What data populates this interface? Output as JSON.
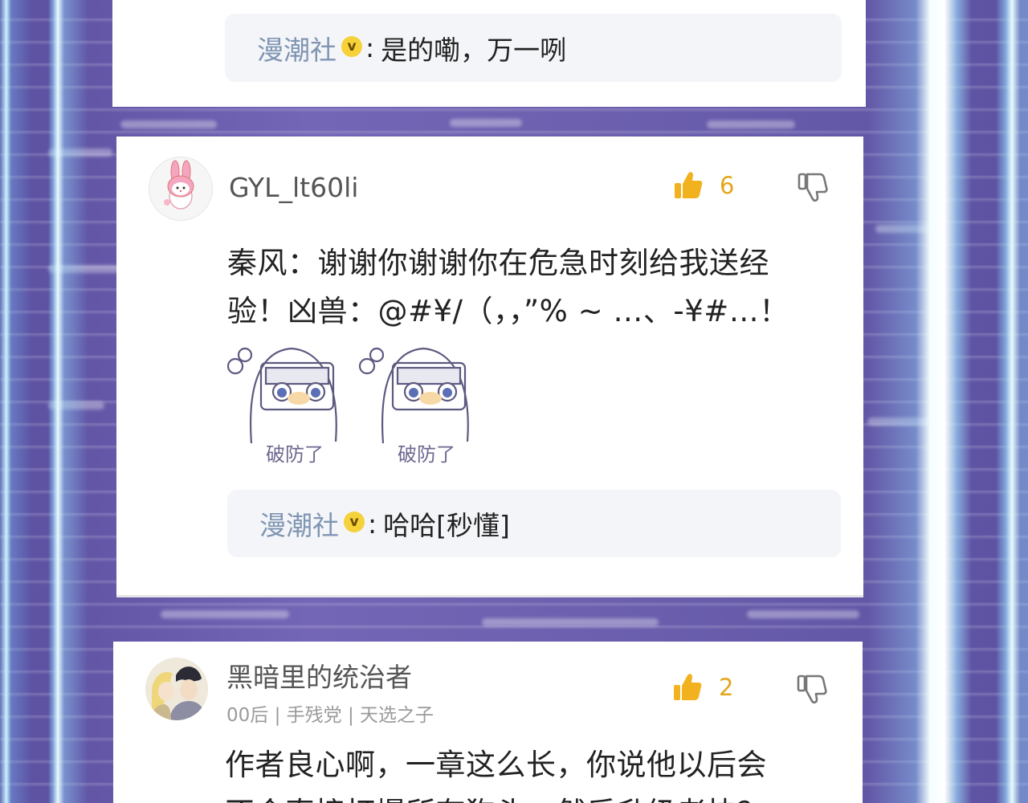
{
  "comments": [
    {
      "reply": {
        "name": "漫潮社",
        "text": "是的嘞，万一咧"
      }
    },
    {
      "username": "GYL_lt60li",
      "likes": "6",
      "text_lines": [
        "秦风：谢谢你谢谢你在危急时刻给我送经",
        "验！凶兽：@#¥/（，，”% ~ …、-¥#…！"
      ],
      "stickers": [
        {
          "caption": "破防了"
        },
        {
          "caption": "破防了"
        }
      ],
      "reply": {
        "name": "漫潮社",
        "text": "哈哈[秒懂]"
      }
    },
    {
      "username": "黑暗里的统治者",
      "tags": "00后 | 手残党 | 天选之子",
      "likes": "2",
      "text_lines": [
        "作者良心啊，一章这么长，你说他以后会",
        "不会直接打爆所有狗头，然后升级老快？"
      ]
    }
  ],
  "colors": {
    "like": "#e3a51c",
    "reply_name": "#7f95b3",
    "badge": "#f5d13a"
  },
  "icons": [
    "thumbs-up-icon",
    "thumbs-down-icon",
    "verified-badge-icon"
  ]
}
